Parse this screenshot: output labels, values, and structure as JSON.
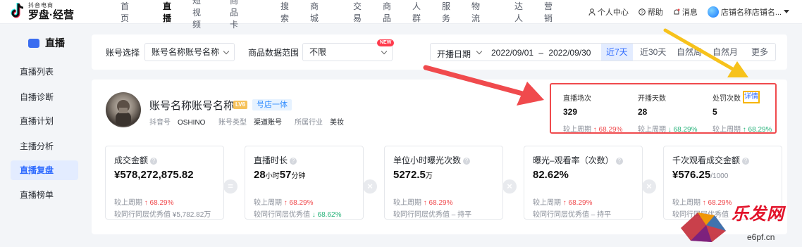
{
  "header": {
    "logo_sub": "抖音电商",
    "logo_main": "罗盘·经营",
    "nav": [
      "首页",
      "直播",
      "短视频",
      "商品卡",
      "搜索",
      "商城",
      "交易",
      "商品",
      "人群",
      "服务",
      "物流",
      "达人",
      "营销"
    ],
    "personal_center": "个人中心",
    "help": "帮助",
    "messages": "消息",
    "shop_name": "店铺名称店铺名..."
  },
  "sidebar": {
    "title": "直播",
    "items": [
      "直播列表",
      "自播诊断",
      "直播计划",
      "主播分析",
      "直播复盘",
      "直播榜单"
    ]
  },
  "filter": {
    "account_label": "账号选择",
    "account_value": "账号名称账号名称",
    "scope_label": "商品数据范围",
    "scope_value": "不限",
    "new_badge": "NEW",
    "date_label": "开播日期",
    "date_range": "2022/09/01 – 2022/09/30",
    "quick_ranges": [
      "近7天",
      "近30天",
      "自然周",
      "自然月",
      "更多"
    ]
  },
  "account": {
    "name": "账号名称账号名称",
    "level": "LV6",
    "tag": "号店一体",
    "douyin_id_label": "抖音号",
    "douyin_id": "OSHINO",
    "type_label": "账号类型",
    "type": "渠道账号",
    "industry_label": "所属行业",
    "industry": "美妆"
  },
  "summary": {
    "detail": "详情",
    "items": [
      {
        "label": "直播场次",
        "value": "329",
        "prev": "较上周期",
        "delta": "↑ 68.29%",
        "dir": "up"
      },
      {
        "label": "开播天数",
        "value": "28",
        "prev": "较上周期",
        "delta": "↓ 68.29%",
        "dir": "down"
      },
      {
        "label": "处罚次数",
        "value": "5",
        "prev": "较上周期",
        "delta": "↑ 68.29%",
        "dir": "down"
      }
    ]
  },
  "metrics": [
    {
      "label": "成交金额",
      "value": "¥578,272,875.82",
      "l1a": "较上周期",
      "l1b": "↑ 68.29%",
      "l2a": "较同行同层优秀值",
      "l2b": "¥5,782.82万"
    },
    {
      "label": "直播时长",
      "v1": "28",
      "u1": "小时",
      "v2": "57",
      "u2": "分钟",
      "l1a": "较上周期",
      "l1b": "↑ 68.29%",
      "l2a": "较同行同层优秀值",
      "l2b": "↓ 68.62%"
    },
    {
      "label": "单位小时曝光次数",
      "value": "5272.5",
      "unit": "万",
      "l1a": "较上周期",
      "l1b": "↑ 68.29%",
      "l2a": "较同行同层优秀值",
      "l2b": "– 持平"
    },
    {
      "label": "曝光–观看率（次数）",
      "value": "82.62%",
      "l1a": "较上周期",
      "l1b": "↑ 68.29%",
      "l2a": "较同行同层优秀值",
      "l2b": "– 持平"
    },
    {
      "label": "千次观看成交金额",
      "value": "¥576.25",
      "unit": "/1000",
      "l1a": "较上周期",
      "l1b": "↑ 68.29%",
      "l2a": "较同行同层优秀值",
      "l2b": ""
    }
  ],
  "operators": [
    "=",
    "×",
    "×",
    "×"
  ],
  "watermark": {
    "text": "乐发网",
    "url": "e6pf.cn"
  }
}
